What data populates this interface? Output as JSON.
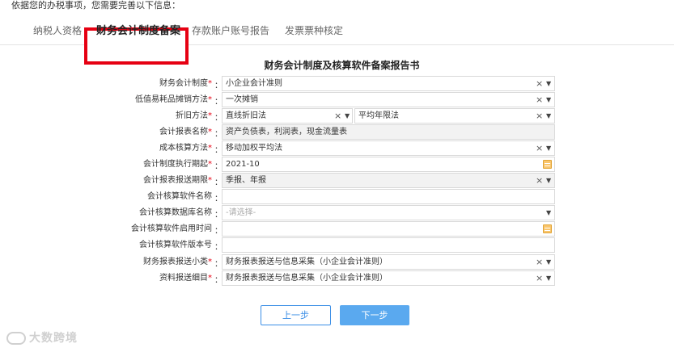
{
  "intro": "依据您的办税事项，您需要完善以下信息：",
  "tabs": [
    {
      "label": "纳税人资格"
    },
    {
      "label": "财务会计制度备案"
    },
    {
      "label": "存款账户账号报告"
    },
    {
      "label": "发票票种核定"
    }
  ],
  "form": {
    "title": "财务会计制度及核算软件备案报告书",
    "colon": "：",
    "rows": [
      {
        "label": "财务会计制度",
        "required": "*",
        "value": "小企业会计准则"
      },
      {
        "label": "低值易耗品摊销方法",
        "required": "*",
        "value": "一次摊销"
      },
      {
        "label": "折旧方法",
        "required": "*",
        "value": "直线折旧法",
        "value2": "平均年限法"
      },
      {
        "label": "会计报表名称",
        "required": "*",
        "value": "资产负债表，利润表，现金流量表"
      },
      {
        "label": "成本核算方法",
        "required": "*",
        "value": "移动加权平均法"
      },
      {
        "label": "会计制度执行期起",
        "required": "*",
        "value": "2021-10"
      },
      {
        "label": "会计报表报送期限",
        "required": "*",
        "value": "季报、年报"
      },
      {
        "label": "会计核算软件名称",
        "required": "",
        "value": ""
      },
      {
        "label": "会计核算数据库名称",
        "required": "",
        "placeholder": "-请选择-"
      },
      {
        "label": "会计核算软件启用时间",
        "required": "",
        "value": ""
      },
      {
        "label": "会计核算软件版本号",
        "required": "",
        "value": ""
      },
      {
        "label": "财务报表报送小类",
        "required": "*",
        "value": "财务报表报送与信息采集（小企业会计准则）"
      },
      {
        "label": "资料报送细目",
        "required": "*",
        "value": "财务报表报送与信息采集（小企业会计准则）"
      }
    ]
  },
  "icons": {
    "clear": "×",
    "caret": "▼"
  },
  "buttons": {
    "prev": "上一步",
    "next": "下一步"
  },
  "watermark": "大数跨境",
  "colors": {
    "accent": "#3a8ee6",
    "highlight": "#e60012",
    "required": "#e60012"
  }
}
